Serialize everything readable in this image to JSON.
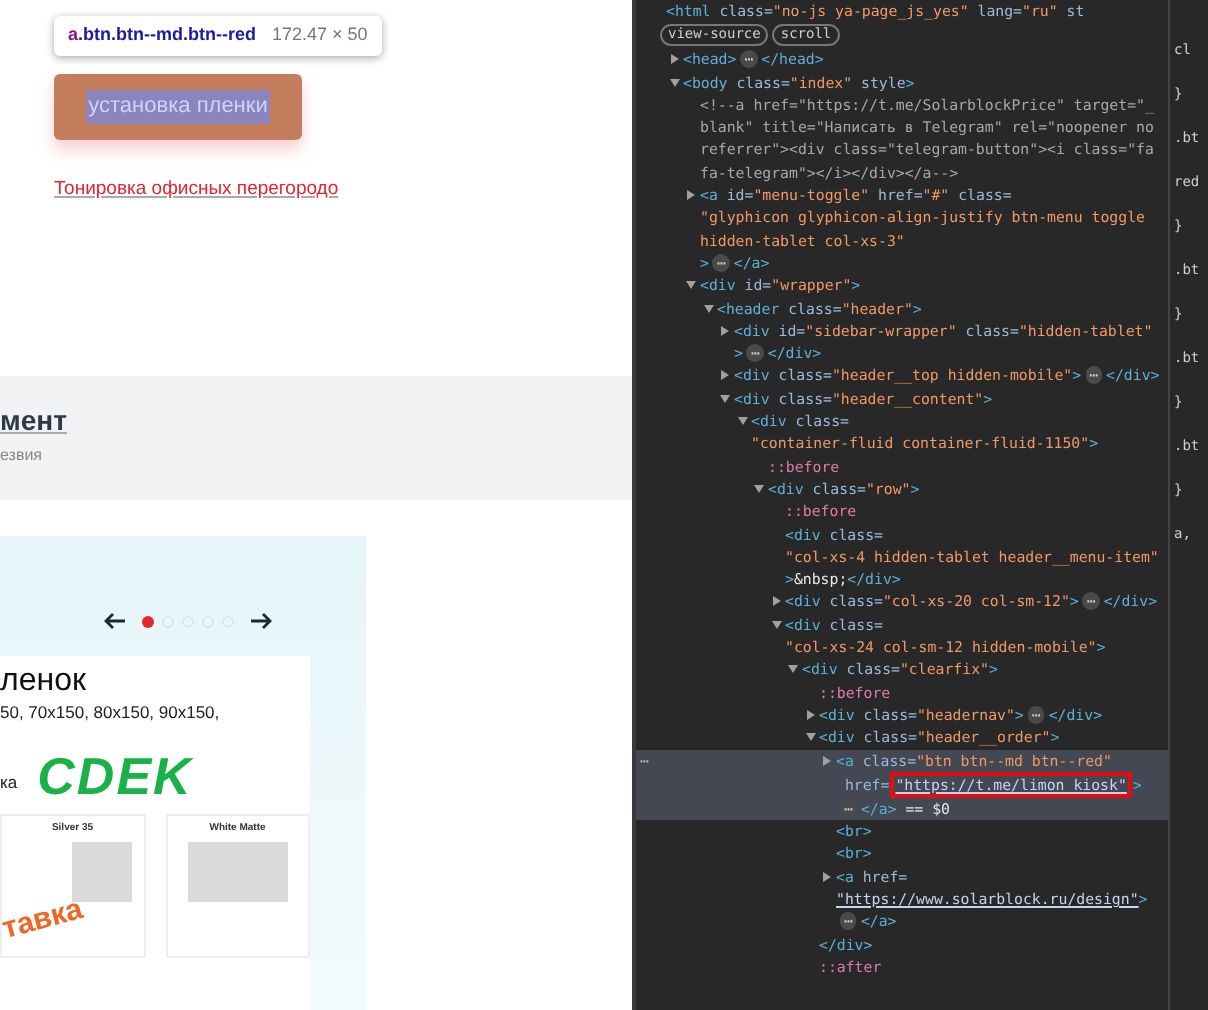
{
  "page": {
    "inspect_tooltip": {
      "tag": "a",
      "classes": ".btn.btn--md.btn--red",
      "size": "172.47 × 50"
    },
    "order_button": {
      "label": "установка пленки"
    },
    "link": "Тонировка офисных перегородо",
    "section": {
      "title": "мент",
      "subtitle": "езвия"
    },
    "slider": {
      "dots": [
        {
          "selected": true
        },
        {
          "selected": false
        },
        {
          "selected": false
        },
        {
          "selected": false
        },
        {
          "selected": false
        }
      ]
    },
    "banner": {
      "title": "ленок",
      "sizes": "50, 70x150, 80x150, 90x150,",
      "delivery": "ка",
      "logo": "CDEK"
    },
    "products": [
      {
        "label": "Silver 35",
        "stamp": "тавка"
      },
      {
        "label": "White Matte"
      }
    ]
  },
  "elements_tree": {
    "nodes": [
      {
        "selected": false,
        "badges": [
          "view-source",
          "scroll"
        ],
        "parts": [
          {
            "kind": "tag",
            "text": "<html"
          },
          {
            "kind": "attr",
            "text": " class="
          },
          {
            "kind": "value",
            "text": "\"no-js ya-page_js_yes\""
          },
          {
            "kind": "attr",
            "text": " lang="
          },
          {
            "kind": "value",
            "text": "\"ru\""
          },
          {
            "kind": "attr",
            "text": " st"
          }
        ],
        "children": [
          {
            "selected": false,
            "expanded": false,
            "parts": [
              {
                "kind": "tag",
                "text": "<head>"
              },
              {
                "kind": "ellipsis",
                "text": "⋯"
              },
              {
                "kind": "tag",
                "text": "</head>"
              }
            ]
          },
          {
            "selected": false,
            "expanded": true,
            "parts": [
              {
                "kind": "tag",
                "text": "<body"
              },
              {
                "kind": "attr",
                "text": " class="
              },
              {
                "kind": "value",
                "text": "\"index\""
              },
              {
                "kind": "attr",
                "text": " style"
              },
              {
                "kind": "tag",
                "text": ">"
              }
            ],
            "children": [
              {
                "selected": false,
                "parts": [
                  {
                    "kind": "comment",
                    "text": "<!--a href=\"https://t.me/SolarblockPrice\" target=\"_blank\" title=\"Написать в Telegram\" rel=\"noopener noreferrer\"><div class=\"telegram-button\"><i class=\"fa fa-telegram\"></i></div></a-->"
                  }
                ]
              },
              {
                "selected": false,
                "expanded": false,
                "parts": [
                  {
                    "kind": "tag",
                    "text": "<a"
                  },
                  {
                    "kind": "attr",
                    "text": " id="
                  },
                  {
                    "kind": "value",
                    "text": "\"menu-toggle\""
                  },
                  {
                    "kind": "attr",
                    "text": " href="
                  },
                  {
                    "kind": "value",
                    "text": "\"#\""
                  },
                  {
                    "kind": "attr",
                    "text": " class="
                  },
                  {
                    "kind": "value",
                    "text": "\"glyphicon glyphicon-align-justify btn-menu toggle hidden-tablet col-xs-3\""
                  },
                  {
                    "kind": "tag",
                    "text": ">"
                  },
                  {
                    "kind": "ellipsis",
                    "text": "⋯"
                  },
                  {
                    "kind": "tag",
                    "text": "</a>"
                  }
                ]
              },
              {
                "selected": false,
                "expanded": true,
                "parts": [
                  {
                    "kind": "tag",
                    "text": "<div"
                  },
                  {
                    "kind": "attr",
                    "text": " id="
                  },
                  {
                    "kind": "value",
                    "text": "\"wrapper\""
                  },
                  {
                    "kind": "tag",
                    "text": ">"
                  }
                ],
                "children": [
                  {
                    "selected": false,
                    "expanded": true,
                    "parts": [
                      {
                        "kind": "tag",
                        "text": "<header"
                      },
                      {
                        "kind": "attr",
                        "text": " class="
                      },
                      {
                        "kind": "value",
                        "text": "\"header\""
                      },
                      {
                        "kind": "tag",
                        "text": ">"
                      }
                    ],
                    "children": [
                      {
                        "selected": false,
                        "expanded": false,
                        "parts": [
                          {
                            "kind": "tag",
                            "text": "<div"
                          },
                          {
                            "kind": "attr",
                            "text": " id="
                          },
                          {
                            "kind": "value",
                            "text": "\"sidebar-wrapper\""
                          },
                          {
                            "kind": "attr",
                            "text": " class="
                          },
                          {
                            "kind": "value",
                            "text": "\"hidden-tablet\""
                          },
                          {
                            "kind": "tag",
                            "text": ">"
                          },
                          {
                            "kind": "ellipsis",
                            "text": "⋯"
                          },
                          {
                            "kind": "tag",
                            "text": "</div>"
                          }
                        ]
                      },
                      {
                        "selected": false,
                        "expanded": false,
                        "parts": [
                          {
                            "kind": "tag",
                            "text": "<div"
                          },
                          {
                            "kind": "attr",
                            "text": " class="
                          },
                          {
                            "kind": "value",
                            "text": "\"header__top hidden-mobile\""
                          },
                          {
                            "kind": "tag",
                            "text": ">"
                          },
                          {
                            "kind": "ellipsis",
                            "text": "⋯"
                          },
                          {
                            "kind": "tag",
                            "text": "</div>"
                          }
                        ]
                      },
                      {
                        "selected": false,
                        "expanded": true,
                        "parts": [
                          {
                            "kind": "tag",
                            "text": "<div"
                          },
                          {
                            "kind": "attr",
                            "text": " class="
                          },
                          {
                            "kind": "value",
                            "text": "\"header__content\""
                          },
                          {
                            "kind": "tag",
                            "text": ">"
                          }
                        ],
                        "children": [
                          {
                            "selected": false,
                            "expanded": true,
                            "parts": [
                              {
                                "kind": "tag",
                                "text": "<div"
                              },
                              {
                                "kind": "attr",
                                "text": " class="
                              },
                              {
                                "kind": "value",
                                "text": "\"container-fluid container-fluid-1150\""
                              },
                              {
                                "kind": "tag",
                                "text": ">"
                              }
                            ],
                            "children": [
                              {
                                "selected": false,
                                "parts": [
                                  {
                                    "kind": "pseudo",
                                    "text": "::before"
                                  }
                                ]
                              },
                              {
                                "selected": false,
                                "expanded": true,
                                "parts": [
                                  {
                                    "kind": "tag",
                                    "text": "<div"
                                  },
                                  {
                                    "kind": "attr",
                                    "text": " class="
                                  },
                                  {
                                    "kind": "value",
                                    "text": "\"row\""
                                  },
                                  {
                                    "kind": "tag",
                                    "text": ">"
                                  }
                                ],
                                "children": [
                                  {
                                    "selected": false,
                                    "parts": [
                                      {
                                        "kind": "pseudo",
                                        "text": "::before"
                                      }
                                    ]
                                  },
                                  {
                                    "selected": false,
                                    "parts": [
                                      {
                                        "kind": "tag",
                                        "text": "<div"
                                      },
                                      {
                                        "kind": "attr",
                                        "text": " class="
                                      },
                                      {
                                        "kind": "value",
                                        "text": "\"col-xs-4 hidden-tablet header__menu-item\""
                                      },
                                      {
                                        "kind": "tag",
                                        "text": ">"
                                      },
                                      {
                                        "kind": "text",
                                        "text": "&nbsp;"
                                      },
                                      {
                                        "kind": "tag",
                                        "text": "</div>"
                                      }
                                    ]
                                  },
                                  {
                                    "selected": false,
                                    "expanded": false,
                                    "parts": [
                                      {
                                        "kind": "tag",
                                        "text": "<div"
                                      },
                                      {
                                        "kind": "attr",
                                        "text": " class="
                                      },
                                      {
                                        "kind": "value",
                                        "text": "\"col-xs-20 col-sm-12\""
                                      },
                                      {
                                        "kind": "tag",
                                        "text": ">"
                                      },
                                      {
                                        "kind": "ellipsis",
                                        "text": "⋯"
                                      },
                                      {
                                        "kind": "tag",
                                        "text": "</div>"
                                      }
                                    ]
                                  },
                                  {
                                    "selected": false,
                                    "expanded": true,
                                    "parts": [
                                      {
                                        "kind": "tag",
                                        "text": "<div"
                                      },
                                      {
                                        "kind": "attr",
                                        "text": " class="
                                      },
                                      {
                                        "kind": "value",
                                        "text": "\"col-xs-24 col-sm-12 hidden-mobile\""
                                      },
                                      {
                                        "kind": "tag",
                                        "text": ">"
                                      }
                                    ],
                                    "children": [
                                      {
                                        "selected": false,
                                        "expanded": true,
                                        "parts": [
                                          {
                                            "kind": "tag",
                                            "text": "<div"
                                          },
                                          {
                                            "kind": "attr",
                                            "text": " class="
                                          },
                                          {
                                            "kind": "value",
                                            "text": "\"clearfix\""
                                          },
                                          {
                                            "kind": "tag",
                                            "text": ">"
                                          }
                                        ],
                                        "children": [
                                          {
                                            "selected": false,
                                            "parts": [
                                              {
                                                "kind": "pseudo",
                                                "text": "::before"
                                              }
                                            ]
                                          },
                                          {
                                            "selected": false,
                                            "expanded": false,
                                            "parts": [
                                              {
                                                "kind": "tag",
                                                "text": "<div"
                                              },
                                              {
                                                "kind": "attr",
                                                "text": " class="
                                              },
                                              {
                                                "kind": "value",
                                                "text": "\"headernav\""
                                              },
                                              {
                                                "kind": "tag",
                                                "text": ">"
                                              },
                                              {
                                                "kind": "ellipsis",
                                                "text": "⋯"
                                              },
                                              {
                                                "kind": "tag",
                                                "text": "</div>"
                                              }
                                            ]
                                          },
                                          {
                                            "selected": false,
                                            "expanded": true,
                                            "parts": [
                                              {
                                                "kind": "tag",
                                                "text": "<div"
                                              },
                                              {
                                                "kind": "attr",
                                                "text": " class="
                                              },
                                              {
                                                "kind": "value",
                                                "text": "\"header__order\""
                                              },
                                              {
                                                "kind": "tag",
                                                "text": ">"
                                              }
                                            ],
                                            "close": [
                                              {
                                                "kind": "tag",
                                                "text": "</div>"
                                              }
                                            ],
                                            "children": [
                                              {
                                                "selected": true,
                                                "expanded": false,
                                                "gutter": "⋯",
                                                "parts": [
                                                  {
                                                    "kind": "tag",
                                                    "text": "<a"
                                                  },
                                                  {
                                                    "kind": "attr",
                                                    "text": " class="
                                                  },
                                                  {
                                                    "kind": "value",
                                                    "text": "\"btn btn--md btn--red\""
                                                  },
                                                  {
                                                    "kind": "attr",
                                                    "text": " href="
                                                  },
                                                  {
                                                    "kind": "link",
                                                    "boxed": true,
                                                    "text": "\"https://t.me/limon_kiosk\""
                                                  },
                                                  {
                                                    "kind": "tag",
                                                    "text": ">"
                                                  },
                                                  {
                                                    "kind": "ellipsis",
                                                    "text": "⋯"
                                                  },
                                                  {
                                                    "kind": "tag",
                                                    "text": "</a>"
                                                  },
                                                  {
                                                    "kind": "text",
                                                    "text": " == $0"
                                                  }
                                                ]
                                              },
                                              {
                                                "selected": false,
                                                "parts": [
                                                  {
                                                    "kind": "tag",
                                                    "text": "<br>"
                                                  }
                                                ]
                                              },
                                              {
                                                "selected": false,
                                                "parts": [
                                                  {
                                                    "kind": "tag",
                                                    "text": "<br>"
                                                  }
                                                ]
                                              },
                                              {
                                                "selected": false,
                                                "expanded": false,
                                                "parts": [
                                                  {
                                                    "kind": "tag",
                                                    "text": "<a"
                                                  },
                                                  {
                                                    "kind": "attr",
                                                    "text": " href="
                                                  },
                                                  {
                                                    "kind": "link",
                                                    "boxed": false,
                                                    "text": "\"https://www.solarblock.ru/design\""
                                                  },
                                                  {
                                                    "kind": "tag",
                                                    "text": ">"
                                                  },
                                                  {
                                                    "kind": "ellipsis",
                                                    "text": "⋯"
                                                  },
                                                  {
                                                    "kind": "tag",
                                                    "text": "</a>"
                                                  }
                                                ]
                                              }
                                            ]
                                          },
                                          {
                                            "selected": false,
                                            "parts": [
                                              {
                                                "kind": "pseudo",
                                                "text": "::after"
                                              }
                                            ]
                                          }
                                        ]
                                      }
                                    ]
                                  }
                                ]
                              }
                            ]
                          }
                        ]
                      }
                    ]
                  }
                ]
              }
            ]
          }
        ]
      }
    ]
  },
  "styles_pane": {
    "fragments": [
      "cl",
      "}",
      ".bt",
      "red",
      "}",
      ".bt",
      "}",
      ".bt",
      "}",
      ".bt",
      "}",
      "a,"
    ]
  }
}
